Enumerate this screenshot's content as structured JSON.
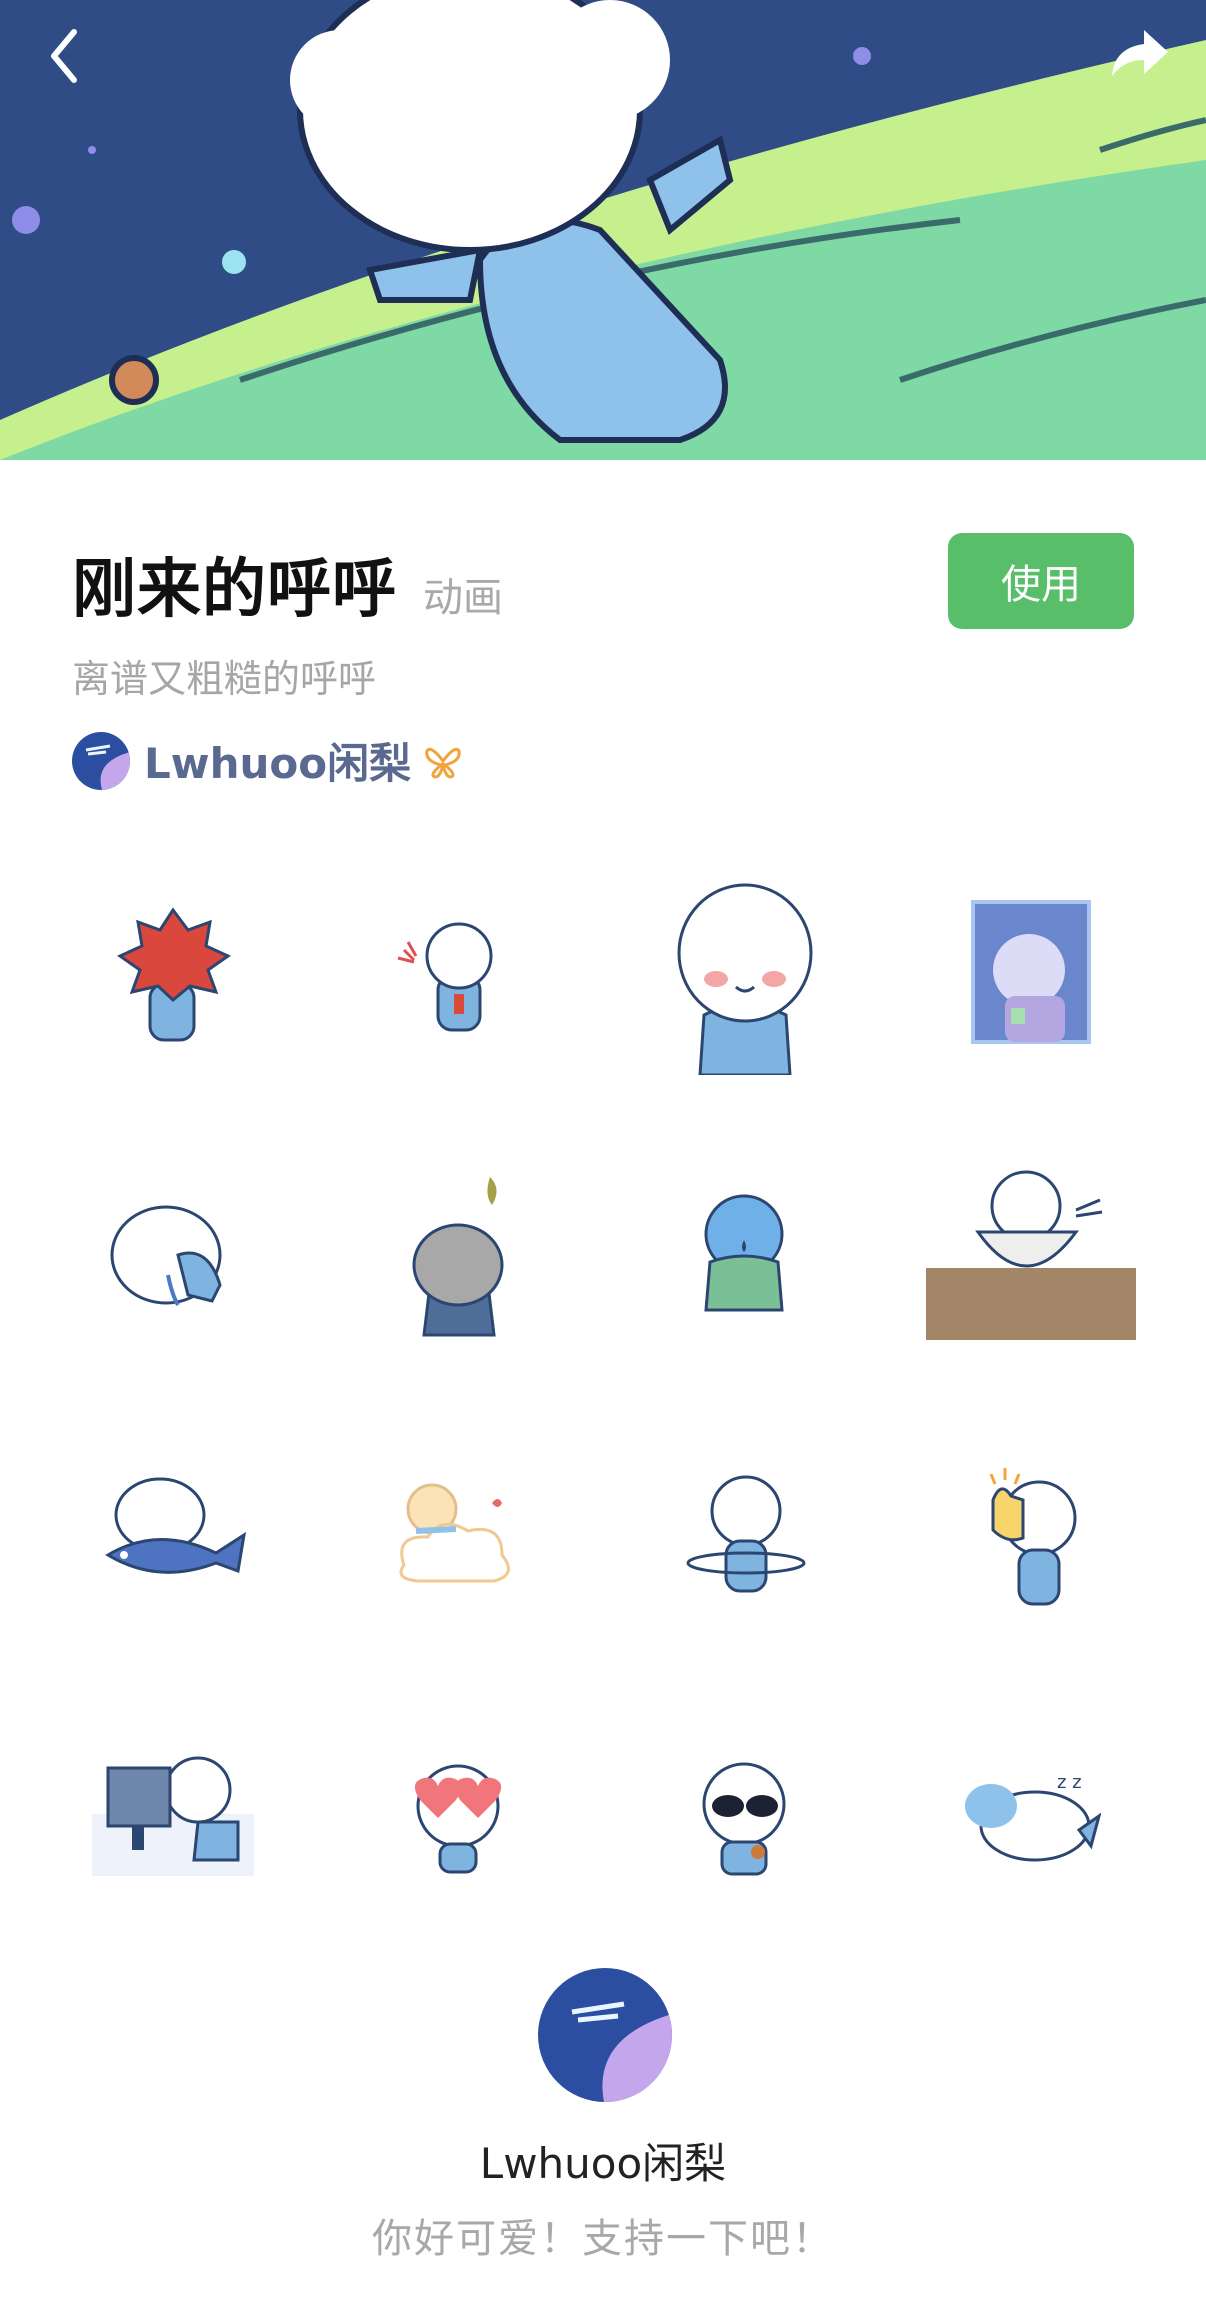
{
  "header": {
    "back_icon": "chevron-left-icon",
    "share_icon": "share-arrow-icon"
  },
  "sticker_pack": {
    "title": "刚来的呼呼",
    "type_tag": "动画",
    "use_label": "使用",
    "subtitle": "离谱又粗糙的呼呼",
    "author": "Lwhuoo闲梨",
    "accent_color": "#58be6a"
  },
  "stickers": [
    "red-spiky-hair-sticker",
    "firework-sticker",
    "blushing-sticker",
    "window-sticker",
    "crying-sticker",
    "falling-leaf-sticker",
    "sweating-cold-sticker",
    "eating-bowl-sticker",
    "fish-hug-sticker",
    "cloud-float-sticker",
    "hula-hoop-sticker",
    "thumbs-up-sticker",
    "computer-work-sticker",
    "heart-eyes-sticker",
    "sunglasses-sticker",
    "sleeping-sticker"
  ],
  "footer": {
    "author": "Lwhuoo闲梨",
    "thanks_text": "你好可爱！支持一下吧！"
  }
}
